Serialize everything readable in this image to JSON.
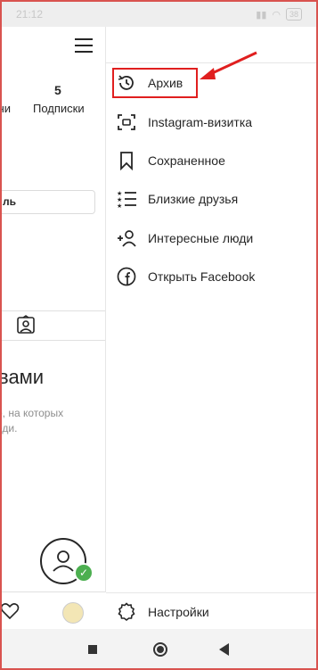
{
  "statusbar": {
    "time": "21:12",
    "battery": "38"
  },
  "profile": {
    "following_count": "5",
    "followers_label_fragment": "чи",
    "following_label": "Подписки",
    "edit_button_fragment": "ль",
    "section_title_fragment": "вами",
    "section_desc_line1": "о, на которых",
    "section_desc_line2": "оди."
  },
  "menu": {
    "items": [
      {
        "label": "Архив",
        "icon": "archive-history-icon"
      },
      {
        "label": "Instagram-визитка",
        "icon": "nametag-icon"
      },
      {
        "label": "Сохраненное",
        "icon": "bookmark-icon"
      },
      {
        "label": "Близкие друзья",
        "icon": "close-friends-list-icon"
      },
      {
        "label": "Интересные люди",
        "icon": "add-person-icon"
      },
      {
        "label": "Открыть Facebook",
        "icon": "facebook-icon"
      }
    ],
    "settings_label": "Настройки"
  },
  "colors": {
    "highlight": "#e01f1f",
    "accent_check": "#4caf50"
  }
}
